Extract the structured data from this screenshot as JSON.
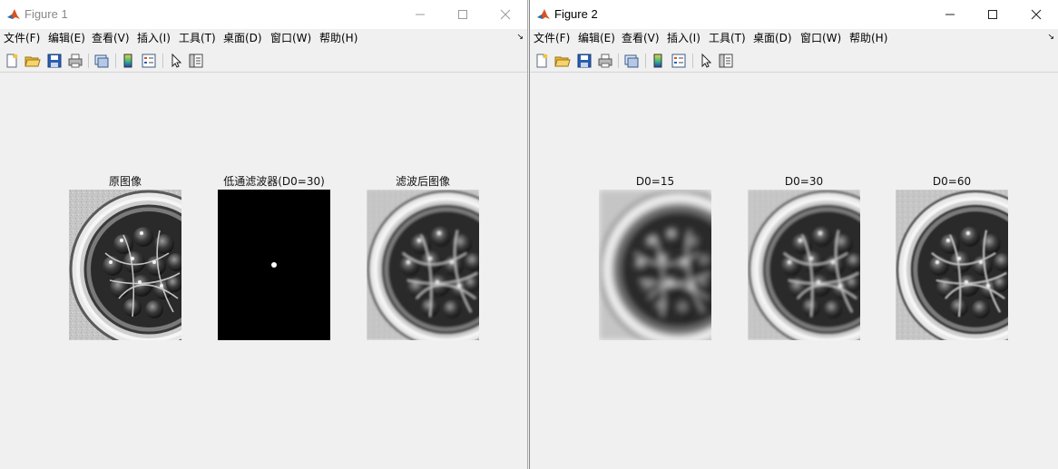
{
  "menu": [
    "文件(F)",
    "编辑(E)",
    "查看(V)",
    "插入(I)",
    "工具(T)",
    "桌面(D)",
    "窗口(W)",
    "帮助(H)"
  ],
  "figure1": {
    "title": "Figure 1",
    "titles": [
      "原图像",
      "低通滤波器(D0=30)",
      "滤波后图像"
    ]
  },
  "figure2": {
    "title": "Figure 2",
    "titles": [
      "D0=15",
      "D0=30",
      "D0=60"
    ]
  },
  "icons": [
    "new-file-icon",
    "open-folder-icon",
    "save-icon",
    "print-icon",
    "link-plot-icon",
    "colorbar-icon",
    "legend-icon",
    "pointer-icon",
    "property-inspector-icon"
  ],
  "colors": {
    "matlab_logo": "#d9531e",
    "filter_background": "#000000",
    "filter_dot": "#ffffff"
  }
}
